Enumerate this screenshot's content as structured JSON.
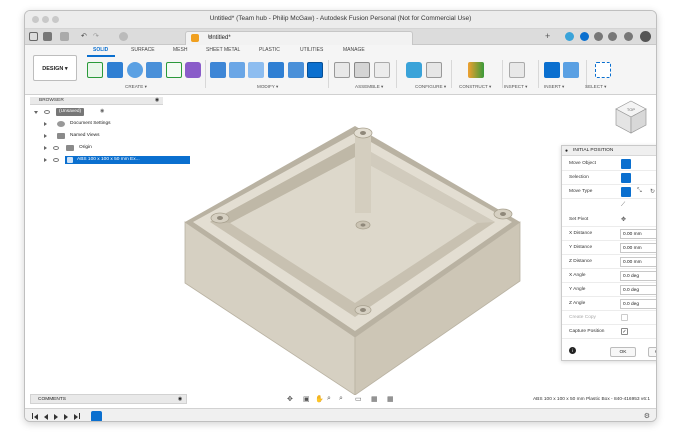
{
  "window": {
    "title": "Untitled* (Team hub - Philip McGaw) - Autodesk Fusion Personal (Not for Commercial Use)"
  },
  "tabbar": {
    "document_tab": "Untitled*"
  },
  "ribbon": {
    "workspace": "DESIGN ▾",
    "tabs": [
      "SOLID",
      "SURFACE",
      "MESH",
      "SHEET METAL",
      "PLASTIC",
      "UTILITIES",
      "MANAGE"
    ],
    "active_tab": "SOLID",
    "groups": [
      "CREATE ▾",
      "MODIFY ▾",
      "ASSEMBLE ▾",
      "CONFIGURE ▾",
      "CONSTRUCT ▾",
      "INSPECT ▾",
      "INSERT ▾",
      "SELECT ▾"
    ]
  },
  "browser": {
    "title": "BROWSER",
    "items": [
      {
        "label": "(Unsaved)",
        "level": 0
      },
      {
        "label": "Document Settings",
        "level": 1
      },
      {
        "label": "Named Views",
        "level": 1
      },
      {
        "label": "Origin",
        "level": 1
      },
      {
        "label": "ABS 100 x 100 x 50 mm Ex...",
        "level": 1
      }
    ]
  },
  "initial_position": {
    "title": "INITIAL POSITION",
    "rows": {
      "move_object": "Move Object",
      "selection": "Selection",
      "move_type": "Move Type",
      "set_pivot": "Set Pivot",
      "x_distance_label": "X Distance",
      "x_distance": "0.00 mm",
      "y_distance_label": "Y Distance",
      "y_distance": "0.00 mm",
      "z_distance_label": "Z Distance",
      "z_distance": "0.00 mm",
      "x_angle_label": "X Angle",
      "x_angle": "0.0 deg",
      "y_angle_label": "Y Angle",
      "y_angle": "0.0 deg",
      "z_angle_label": "Z Angle",
      "z_angle": "0.0 deg",
      "create_copy": "Create Copy",
      "capture_position": "Capture Position"
    },
    "ok_label": "OK",
    "cancel_label": "Cancel"
  },
  "viewcube": {
    "face": "TOP"
  },
  "bottom": {
    "comments": "COMMENTS",
    "status_text": "ABS 100 x 100 x 50 mm Plastic Box - 840-416953 v6:1"
  },
  "colors": {
    "accent": "#0a6fcf",
    "model_body": "#d6d0c2",
    "model_shadow": "#b9b2a2"
  }
}
